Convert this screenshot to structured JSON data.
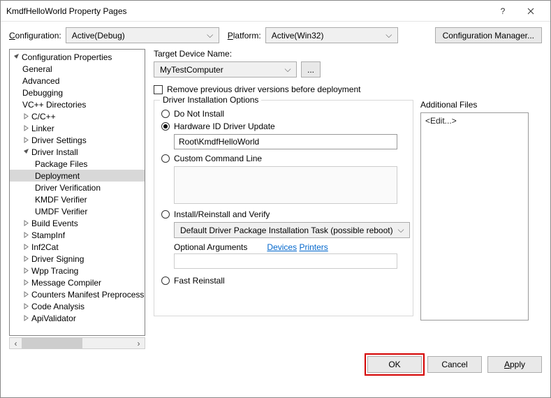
{
  "title": "KmdfHelloWorld Property Pages",
  "top": {
    "config_label": "Configuration:",
    "config_value": "Active(Debug)",
    "platform_label": "Platform:",
    "platform_value": "Active(Win32)",
    "cfgmgr": "Configuration Manager..."
  },
  "tree": {
    "root": "Configuration Properties",
    "items": [
      "General",
      "Advanced",
      "Debugging",
      "VC++ Directories",
      "C/C++",
      "Linker",
      "Driver Settings",
      "Driver Install",
      "Package Files",
      "Deployment",
      "Driver Verification",
      "KMDF Verifier",
      "UMDF Verifier",
      "Build Events",
      "StampInf",
      "Inf2Cat",
      "Driver Signing",
      "Wpp Tracing",
      "Message Compiler",
      "Counters Manifest Preprocess",
      "Code Analysis",
      "ApiValidator"
    ]
  },
  "content": {
    "target_label": "Target Device Name:",
    "target_value": "MyTestComputer",
    "browse": "...",
    "remove_label": "Remove previous driver versions before deployment",
    "install_legend": "Driver Installation Options",
    "opt_do_not": "Do Not Install",
    "opt_hw": "Hardware ID Driver Update",
    "hw_value": "Root\\KmdfHelloWorld",
    "opt_custom": "Custom Command Line",
    "opt_install": "Install/Reinstall and Verify",
    "install_combo": "Default Driver Package Installation Task (possible reboot)",
    "optional_args": "Optional Arguments",
    "link_devices": "Devices",
    "link_printers": "Printers",
    "opt_fast": "Fast Reinstall",
    "addl_label": "Additional Files",
    "edit": "<Edit...>"
  },
  "footer": {
    "ok": "OK",
    "cancel": "Cancel",
    "apply": "Apply"
  }
}
